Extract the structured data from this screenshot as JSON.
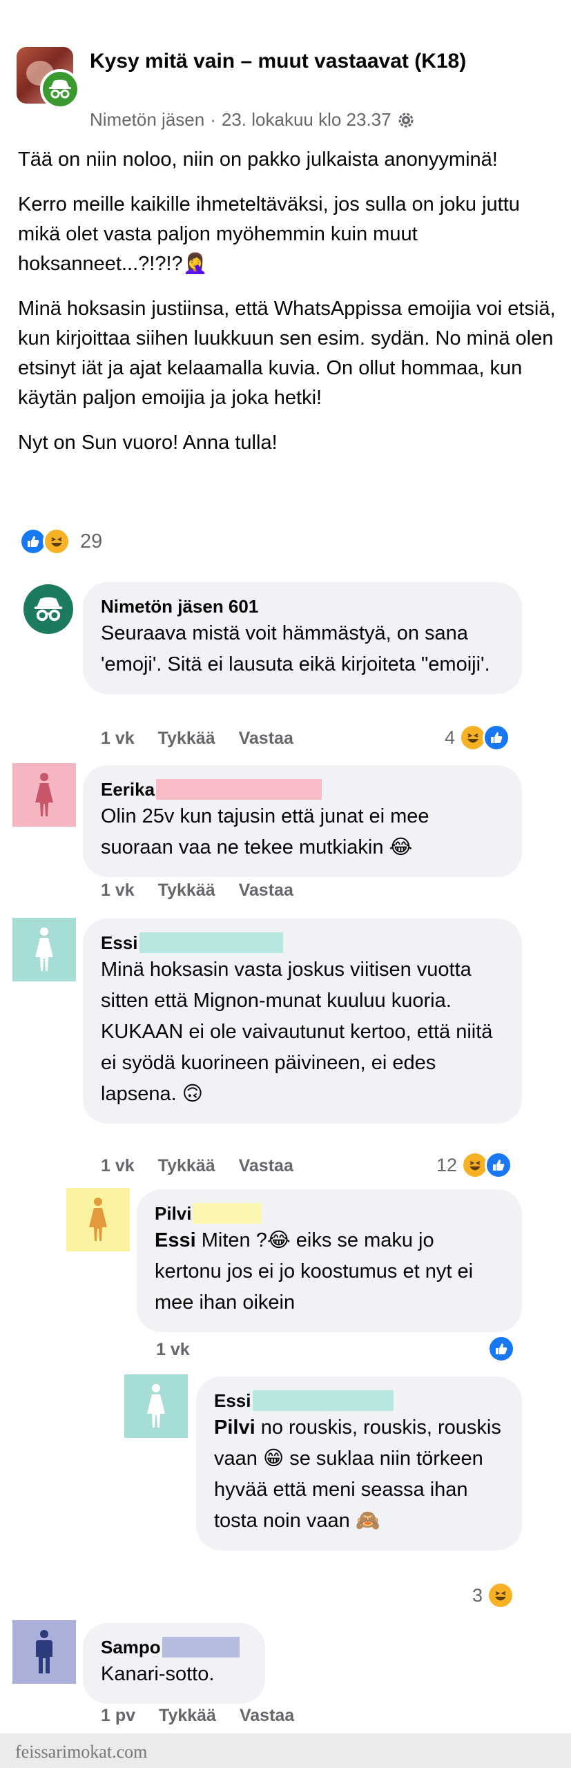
{
  "post": {
    "group_title": "Kysy mitä vain – muut vastaavat (K18)",
    "author": "Nimetön jäsen",
    "separator": "·",
    "date": "23. lokakuu klo 23.37",
    "audience_icon": "settings-gear-icon",
    "paragraphs": [
      "Tää on niin noloo, niin on pakko julkaista anonyyminä!",
      "Kerro meille kaikille ihmeteltäväksi, jos sulla on joku juttu mikä olet vasta paljon myöhemmin kuin muut hoksanneet...?!?!?🤦‍♀️",
      "Minä hoksasin justiinsa, että WhatsAppissa  emoijia voi etsiä, kun kirjoittaa siihen luukkuun sen esim. sydän. No minä olen etsinyt iät ja ajat kelaamalla kuvia. On ollut hommaa, kun käytän paljon emoijia ja joka hetki!",
      "Nyt on Sun vuoro! Anna tulla!"
    ],
    "reaction_count": "29"
  },
  "labels": {
    "like": "Tykkää",
    "reply": "Vastaa"
  },
  "comments": [
    {
      "name": "Nimetön jäsen 601",
      "text": "Seuraava mistä voit hämmästyä, on sana 'emoji'. Sitä ei lausuta eikä kirjoiteta \"emoiji'.",
      "time": "1 vk",
      "reactions": "4"
    },
    {
      "name": "Eerika",
      "text": "Olin 25v kun tajusin että junat ei mee suoraan vaa ne tekee mutkiakin 😂",
      "time": "1 vk"
    },
    {
      "name": "Essi",
      "text": "Minä hoksasin vasta joskus viitisen vuotta sitten että Mignon-munat kuuluu kuoria. KUKAAN ei ole vaivautunut kertoo, että niitä ei syödä kuorineen päivineen, ei edes lapsena. 🙃",
      "time": "1 vk",
      "reactions": "12"
    },
    {
      "name": "Pilvi",
      "mention": "Essi",
      "text": " Miten ?😂 eiks se maku jo kertonu jos ei jo koostumus et nyt ei mee ihan oikein",
      "time": "1 vk"
    },
    {
      "name": "Essi",
      "mention": "Pilvi",
      "text": " no rouskis, rouskis, rouskis vaan 😁 se suklaa niin törkeen hyvää että meni seassa ihan tosta noin vaan 🙈",
      "reactions": "3"
    },
    {
      "name": "Sampo",
      "text": "Kanari-sotto.",
      "time": "1 pv"
    }
  ],
  "watermark": "feissarimokat.com",
  "colors": {
    "pink_avatar": "#f5b6c1",
    "teal_avatar": "#a6ddd6",
    "yellow_avatar": "#fbf3a0",
    "blue_avatar": "#aab0da",
    "anon_green": "#1c7a5e"
  }
}
